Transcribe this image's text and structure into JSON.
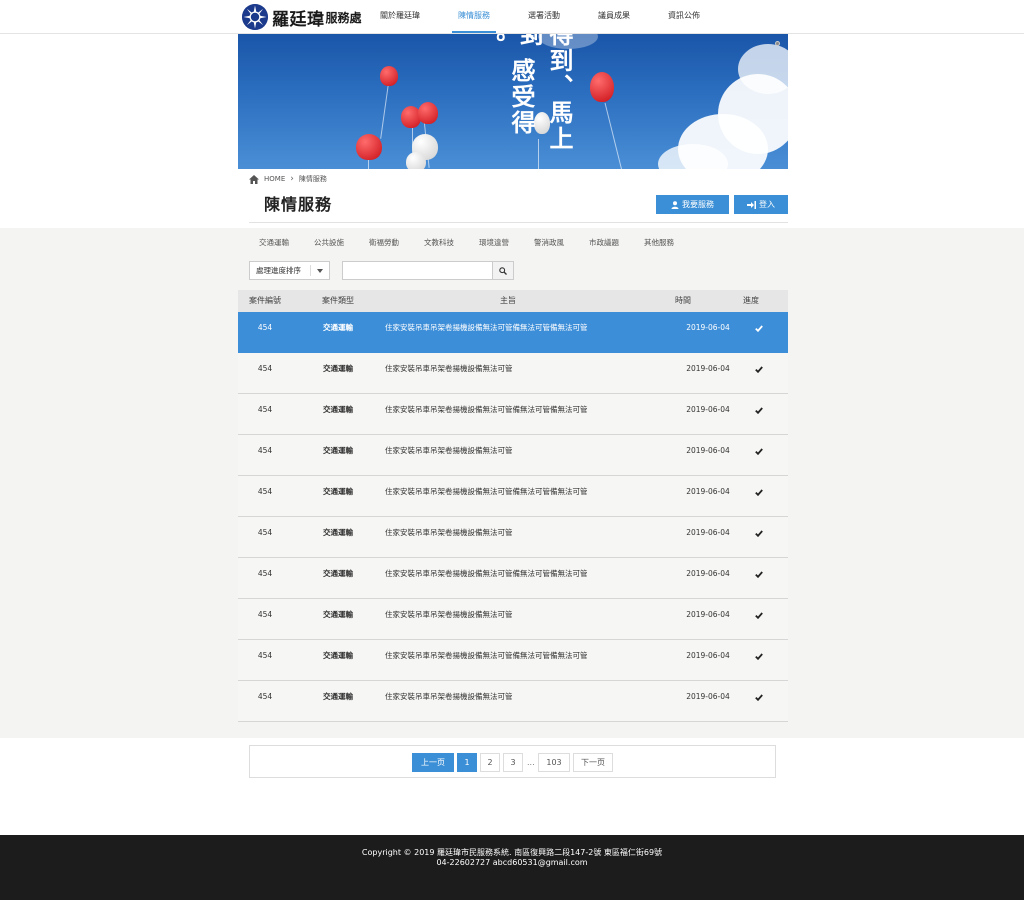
{
  "header": {
    "logo_text": "羅廷瑋",
    "logo_sub": "服務處",
    "nav": [
      {
        "label": "關於羅廷瑋",
        "active": false
      },
      {
        "label": "陳情服務",
        "active": true
      },
      {
        "label": "選署活動",
        "active": false
      },
      {
        "label": "議員成果",
        "active": false
      },
      {
        "label": "資訊公佈",
        "active": false
      }
    ]
  },
  "banner": {
    "text_col1": "得到、馬上到",
    "text_col2": "到、感受得到。"
  },
  "breadcrumb": {
    "home": "HOME",
    "current": "陳情服務"
  },
  "page": {
    "title": "陳情服務",
    "request_button": "我要服務",
    "login_button": "登入"
  },
  "categories": [
    "交通運輸",
    "公共設施",
    "衛福勞動",
    "文教科技",
    "環境違營",
    "警消政風",
    "市政議題",
    "其他服務"
  ],
  "filters": {
    "sort_label": "處理進度排序",
    "search_value": "",
    "search_placeholder": ""
  },
  "table": {
    "headers": {
      "id": "案件編號",
      "type": "案件類型",
      "subject": "主旨",
      "date": "時間",
      "progress": "進度"
    },
    "rows": [
      {
        "id": "454",
        "type": "交通運輸",
        "subject": "住家安裝吊車吊架卷揚機設備無法可管備無法可管備無法可管",
        "date": "2019-06-04",
        "selected": true
      },
      {
        "id": "454",
        "type": "交通運輸",
        "subject": "住家安裝吊車吊架卷揚機設備無法可管",
        "date": "2019-06-04",
        "selected": false
      },
      {
        "id": "454",
        "type": "交通運輸",
        "subject": "住家安裝吊車吊架卷揚機設備無法可管備無法可管備無法可管",
        "date": "2019-06-04",
        "selected": false
      },
      {
        "id": "454",
        "type": "交通運輸",
        "subject": "住家安裝吊車吊架卷揚機設備無法可管",
        "date": "2019-06-04",
        "selected": false
      },
      {
        "id": "454",
        "type": "交通運輸",
        "subject": "住家安裝吊車吊架卷揚機設備無法可管備無法可管備無法可管",
        "date": "2019-06-04",
        "selected": false
      },
      {
        "id": "454",
        "type": "交通運輸",
        "subject": "住家安裝吊車吊架卷揚機設備無法可管",
        "date": "2019-06-04",
        "selected": false
      },
      {
        "id": "454",
        "type": "交通運輸",
        "subject": "住家安裝吊車吊架卷揚機設備無法可管備無法可管備無法可管",
        "date": "2019-06-04",
        "selected": false
      },
      {
        "id": "454",
        "type": "交通運輸",
        "subject": "住家安裝吊車吊架卷揚機設備無法可管",
        "date": "2019-06-04",
        "selected": false
      },
      {
        "id": "454",
        "type": "交通運輸",
        "subject": "住家安裝吊車吊架卷揚機設備無法可管備無法可管備無法可管",
        "date": "2019-06-04",
        "selected": false
      },
      {
        "id": "454",
        "type": "交通運輸",
        "subject": "住家安裝吊車吊架卷揚機設備無法可管",
        "date": "2019-06-04",
        "selected": false
      }
    ]
  },
  "pagination": {
    "prev": "上一页",
    "pages": [
      "1",
      "2",
      "3"
    ],
    "ellipsis": "...",
    "last": "103",
    "next": "下一页",
    "current": "1"
  },
  "footer": {
    "line1": "Copyright © 2019 羅廷瑋市民服務系統. 南區復興路二段147-2號 東區福仁街69號",
    "line2": "04-22602727 abcd60531@gmail.com"
  },
  "colors": {
    "accent": "#3b8fd6",
    "selected_row": "#3d8ed8",
    "footer_bg": "#1c1c1c",
    "content_bg": "#f4f4f2"
  }
}
